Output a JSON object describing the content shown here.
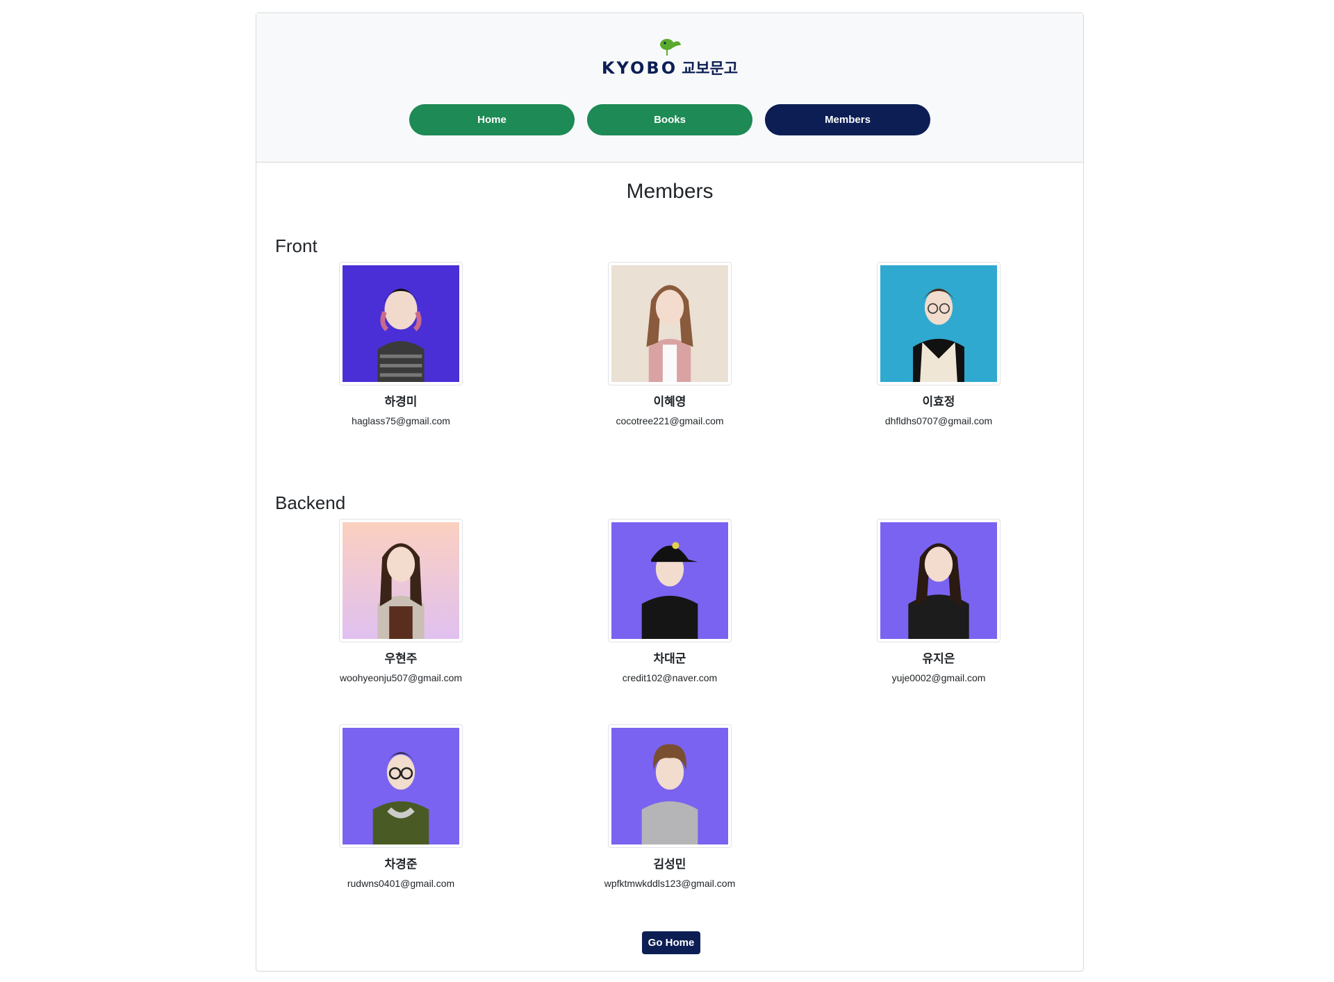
{
  "logo": {
    "text_en": "KYOBO",
    "text_ko": "교보문고",
    "accent": "#5aab2d",
    "color": "#0c1e54"
  },
  "nav": [
    {
      "label": "Home",
      "active": false
    },
    {
      "label": "Books",
      "active": false
    },
    {
      "label": "Members",
      "active": true
    }
  ],
  "page_title": "Members",
  "sections": [
    {
      "title": "Front",
      "members": [
        {
          "name": "하경미",
          "email": "haglass75@gmail.com",
          "bg": "#4a2fd6"
        },
        {
          "name": "이혜영",
          "email": "cocotree221@gmail.com",
          "bg": "#eae0d3"
        },
        {
          "name": "이효정",
          "email": "dhfldhs0707@gmail.com",
          "bg": "#2fa9cf"
        }
      ]
    },
    {
      "title": "Backend",
      "members": [
        {
          "name": "우현주",
          "email": "woohyeonju507@gmail.com",
          "bg": "#f6c8c8"
        },
        {
          "name": "차대군",
          "email": "credit102@naver.com",
          "bg": "#7a63f0"
        },
        {
          "name": "유지은",
          "email": "yuje0002@gmail.com",
          "bg": "#7a63f0"
        },
        {
          "name": "차경준",
          "email": "rudwns0401@gmail.com",
          "bg": "#7a63f0"
        },
        {
          "name": "김성민",
          "email": "wpfktmwkddls123@gmail.com",
          "bg": "#7a63f0"
        }
      ]
    }
  ],
  "go_home_label": "Go Home",
  "colors": {
    "green": "#1e8a55",
    "navy": "#0c1e54"
  }
}
